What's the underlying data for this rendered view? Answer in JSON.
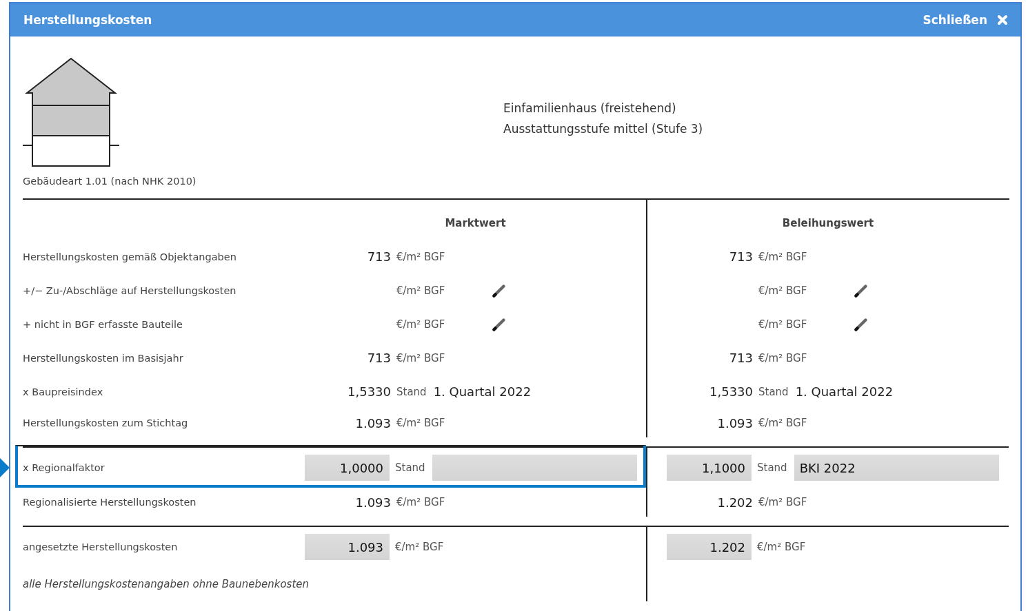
{
  "window": {
    "title": "Herstellungskosten",
    "close_label": "Schließen"
  },
  "building": {
    "caption": "Gebäudeart 1.01 (nach NHK 2010)",
    "description": [
      "Einfamilienhaus (freistehend)",
      "Ausstattungsstufe mittel (Stufe 3)"
    ]
  },
  "columns": [
    "Marktwert",
    "Beleihungswert"
  ],
  "rows": [
    {
      "label": "Herstellungskosten gemäß Objektangaben",
      "kind": "value",
      "divider_above": false,
      "highlighted": false,
      "cells": [
        {
          "amount": "713",
          "unit": "€/m² BGF"
        },
        {
          "amount": "713",
          "unit": "€/m² BGF"
        }
      ]
    },
    {
      "label": "+/− Zu-/Abschläge auf Herstellungskosten",
      "kind": "edit",
      "divider_above": false,
      "highlighted": false,
      "cells": [
        {
          "unit": "€/m² BGF"
        },
        {
          "unit": "€/m² BGF"
        }
      ]
    },
    {
      "label": "+ nicht in BGF erfasste Bauteile",
      "kind": "edit",
      "divider_above": false,
      "highlighted": false,
      "cells": [
        {
          "unit": "€/m² BGF"
        },
        {
          "unit": "€/m² BGF"
        }
      ]
    },
    {
      "label": "Herstellungskosten im Basisjahr",
      "kind": "value",
      "divider_above": false,
      "highlighted": false,
      "cells": [
        {
          "amount": "713",
          "unit": "€/m² BGF"
        },
        {
          "amount": "713",
          "unit": "€/m² BGF"
        }
      ]
    },
    {
      "label": "x Baupreisindex",
      "kind": "index",
      "divider_above": false,
      "highlighted": false,
      "cells": [
        {
          "amount": "1,5330",
          "stand": "Stand",
          "period": "1. Quartal 2022"
        },
        {
          "amount": "1,5330",
          "stand": "Stand",
          "period": "1. Quartal 2022"
        }
      ]
    },
    {
      "label": "Herstellungskosten zum Stichtag",
      "kind": "value",
      "divider_above": false,
      "highlighted": false,
      "cells": [
        {
          "amount": "1.093",
          "unit": "€/m² BGF"
        },
        {
          "amount": "1.093",
          "unit": "€/m² BGF"
        }
      ]
    },
    {
      "label": "x Regionalfaktor",
      "kind": "input_index",
      "divider_above": true,
      "highlighted": true,
      "cells": [
        {
          "amount": "1,0000",
          "stand": "Stand"
        },
        {
          "amount": "1,1000",
          "stand": "Stand",
          "period": "BKI 2022"
        }
      ]
    },
    {
      "label": "Regionalisierte Herstellungskosten",
      "kind": "value",
      "divider_above": false,
      "highlighted": false,
      "cells": [
        {
          "amount": "1.093",
          "unit": "€/m² BGF"
        },
        {
          "amount": "1.202",
          "unit": "€/m² BGF"
        }
      ]
    },
    {
      "label": "angesetzte Herstellungskosten",
      "kind": "input",
      "divider_above": true,
      "highlighted": false,
      "cells": [
        {
          "amount": "1.093",
          "unit": "€/m² BGF"
        },
        {
          "amount": "1.202",
          "unit": "€/m² BGF"
        }
      ]
    }
  ],
  "note": "alle Herstellungskostenangaben ohne Baunebenkosten"
}
